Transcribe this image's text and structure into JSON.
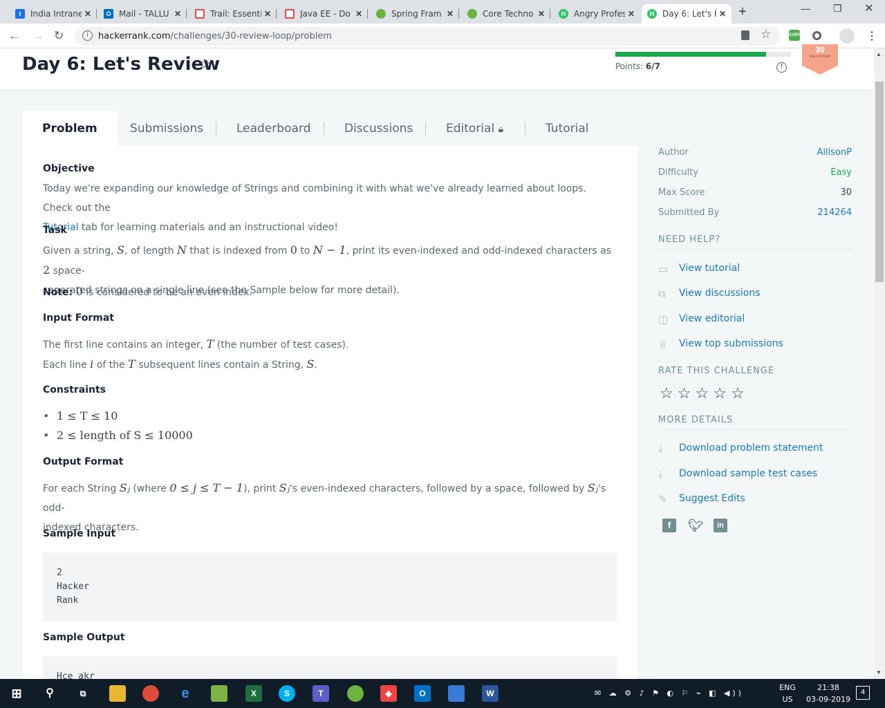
{
  "browser": {
    "tabs": [
      {
        "title": "India Intrane",
        "color": "#1a73e8",
        "letter": "t"
      },
      {
        "title": "Mail - TALLU",
        "color": "#0072c6",
        "letter": "O"
      },
      {
        "title": "Trail: Essentia",
        "color": "#e44",
        "letter": ""
      },
      {
        "title": "Java EE - Do",
        "color": "#e44",
        "letter": ""
      },
      {
        "title": "Spring Fram",
        "color": "#6db33f",
        "letter": ""
      },
      {
        "title": "Core Techno",
        "color": "#6db33f",
        "letter": ""
      },
      {
        "title": "Angry Profes",
        "color": "#2ec866",
        "letter": "H"
      },
      {
        "title": "Day 6: Let's R",
        "color": "#2ec866",
        "letter": "H"
      }
    ],
    "url_host": "hackerrank.com",
    "url_path": "/challenges/30-review-loop/problem",
    "new_tab": "+"
  },
  "header": {
    "title": "Day 6: Let's Review",
    "points_label": "Points:",
    "points_value": "6/7",
    "progress": 0.857,
    "badge_number": "30",
    "badge_text": "Days of Code"
  },
  "tabs": [
    "Problem",
    "Submissions",
    "Leaderboard",
    "Discussions",
    "Editorial",
    "Tutorial"
  ],
  "problem": {
    "objective_h": "Objective",
    "objective_1": "Today we're expanding our knowledge of Strings and combining it with what we've already learned about loops. Check out the",
    "objective_link": "Tutorial",
    "objective_2": " tab for learning materials and an instructional video!",
    "task_h": "Task",
    "task_a": "Given a string, ",
    "task_b": ", of length ",
    "task_c": " that is indexed from ",
    "task_d": " to ",
    "task_e": ", print its even-indexed and odd-indexed characters as ",
    "task_f": " space-",
    "task_g": "separated strings on a single line (see the Sample below for more detail).",
    "note_label": "Note:",
    "note_text": " is considered to be an even index.",
    "input_h": "Input Format",
    "input_1a": "The first line contains an integer, ",
    "input_1b": " (the number of test cases).",
    "input_2a": "Each line ",
    "input_2b": " of the ",
    "input_2c": " subsequent lines contain a String, ",
    "constraints_h": "Constraints",
    "constraint_1": "1 ≤ T ≤ 10",
    "constraint_2": "2 ≤ length of S ≤ 10000",
    "output_h": "Output Format",
    "output_a": "For each String ",
    "output_b": " (where ",
    "output_c": "), print ",
    "output_d": "'s even-indexed characters, followed by a space, followed by ",
    "output_e": "'s odd-",
    "output_f": "indexed characters.",
    "sample_in_h": "Sample Input",
    "sample_in": "2\nHacker\nRank",
    "sample_out_h": "Sample Output",
    "sample_out": "Hce akr"
  },
  "math": {
    "S": "S",
    "N": "N",
    "zero": "0",
    "nminus": "N − 1",
    "two": "2",
    "T": "T",
    "i": "i",
    "Sj": "Sⱼ",
    "range": "0 ≤ j ≤ T − 1"
  },
  "sidebar": {
    "author_k": "Author",
    "author_v": "AllisonP",
    "difficulty_k": "Difficulty",
    "difficulty_v": "Easy",
    "max_k": "Max Score",
    "max_v": "30",
    "sub_k": "Submitted By",
    "sub_v": "214264",
    "help_h": "NEED HELP?",
    "help_links": [
      "View tutorial",
      "View discussions",
      "View editorial",
      "View top submissions"
    ],
    "rate_h": "RATE THIS CHALLENGE",
    "details_h": "MORE DETAILS",
    "detail_links": [
      "Download problem statement",
      "Download sample test cases",
      "Suggest Edits"
    ]
  },
  "taskbar": {
    "lang1": "ENG",
    "lang2": "US",
    "time": "21:38",
    "date": "03-09-2019",
    "notif": "4"
  },
  "colors": {
    "accent": "#1ba94c",
    "link": "#1a7ac0",
    "easy": "#1ba94c"
  }
}
